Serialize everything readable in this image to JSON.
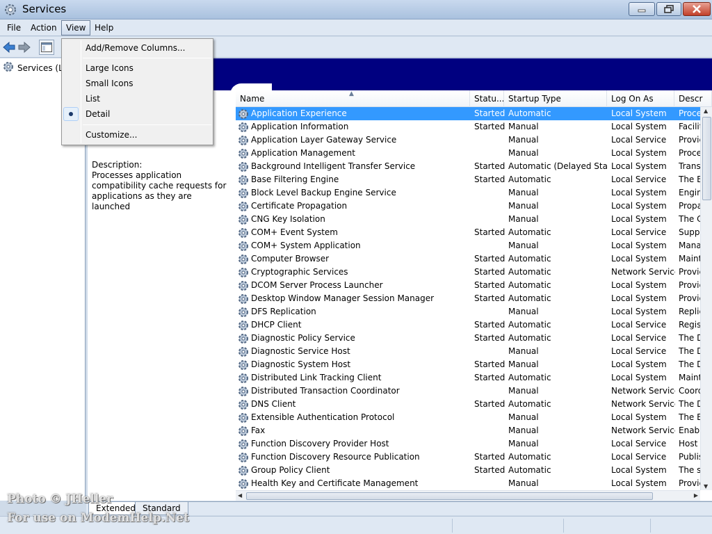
{
  "window": {
    "title": "Services"
  },
  "menubar": {
    "items": [
      "File",
      "Action",
      "View",
      "Help"
    ]
  },
  "tree": {
    "root_label": "Services (Lo"
  },
  "description": {
    "heading": "Description:",
    "text": "Processes application compatibility cache requests for applications as they are launched"
  },
  "view_menu": {
    "add_remove_columns": "Add/Remove Columns...",
    "large_icons": "Large Icons",
    "small_icons": "Small Icons",
    "list": "List",
    "detail": "Detail",
    "customize": "Customize...",
    "checked_item": "Detail"
  },
  "list": {
    "columns": [
      "Name",
      "Statu...",
      "Startup Type",
      "Log On As",
      "Descr"
    ],
    "sorted_column": "Name",
    "selected_row": "Application Experience",
    "rows": [
      {
        "name": "Application Experience",
        "status": "Started",
        "startup": "Automatic",
        "logon": "Local System",
        "desc": "Proce"
      },
      {
        "name": "Application Information",
        "status": "Started",
        "startup": "Manual",
        "logon": "Local System",
        "desc": "Facilit"
      },
      {
        "name": "Application Layer Gateway Service",
        "status": "",
        "startup": "Manual",
        "logon": "Local Service",
        "desc": "Provic"
      },
      {
        "name": "Application Management",
        "status": "",
        "startup": "Manual",
        "logon": "Local System",
        "desc": "Proce"
      },
      {
        "name": "Background Intelligent Transfer Service",
        "status": "Started",
        "startup": "Automatic (Delayed Start)",
        "logon": "Local System",
        "desc": "Trans"
      },
      {
        "name": "Base Filtering Engine",
        "status": "Started",
        "startup": "Automatic",
        "logon": "Local Service",
        "desc": "The B"
      },
      {
        "name": "Block Level Backup Engine Service",
        "status": "",
        "startup": "Manual",
        "logon": "Local System",
        "desc": "Engin"
      },
      {
        "name": "Certificate Propagation",
        "status": "",
        "startup": "Manual",
        "logon": "Local System",
        "desc": "Propa"
      },
      {
        "name": "CNG Key Isolation",
        "status": "",
        "startup": "Manual",
        "logon": "Local System",
        "desc": "The C"
      },
      {
        "name": "COM+ Event System",
        "status": "Started",
        "startup": "Automatic",
        "logon": "Local Service",
        "desc": "Suppo"
      },
      {
        "name": "COM+ System Application",
        "status": "",
        "startup": "Manual",
        "logon": "Local System",
        "desc": "Mana"
      },
      {
        "name": "Computer Browser",
        "status": "Started",
        "startup": "Automatic",
        "logon": "Local System",
        "desc": "Maint"
      },
      {
        "name": "Cryptographic Services",
        "status": "Started",
        "startup": "Automatic",
        "logon": "Network Service",
        "desc": "Provic"
      },
      {
        "name": "DCOM Server Process Launcher",
        "status": "Started",
        "startup": "Automatic",
        "logon": "Local System",
        "desc": "Provic"
      },
      {
        "name": "Desktop Window Manager Session Manager",
        "status": "Started",
        "startup": "Automatic",
        "logon": "Local System",
        "desc": "Provic"
      },
      {
        "name": "DFS Replication",
        "status": "",
        "startup": "Manual",
        "logon": "Local System",
        "desc": "Replic"
      },
      {
        "name": "DHCP Client",
        "status": "Started",
        "startup": "Automatic",
        "logon": "Local Service",
        "desc": "Regist"
      },
      {
        "name": "Diagnostic Policy Service",
        "status": "Started",
        "startup": "Automatic",
        "logon": "Local Service",
        "desc": "The D"
      },
      {
        "name": "Diagnostic Service Host",
        "status": "",
        "startup": "Manual",
        "logon": "Local Service",
        "desc": "The D"
      },
      {
        "name": "Diagnostic System Host",
        "status": "Started",
        "startup": "Manual",
        "logon": "Local System",
        "desc": "The D"
      },
      {
        "name": "Distributed Link Tracking Client",
        "status": "Started",
        "startup": "Automatic",
        "logon": "Local System",
        "desc": "Maint"
      },
      {
        "name": "Distributed Transaction Coordinator",
        "status": "",
        "startup": "Manual",
        "logon": "Network Service",
        "desc": "Coord"
      },
      {
        "name": "DNS Client",
        "status": "Started",
        "startup": "Automatic",
        "logon": "Network Service",
        "desc": "The D"
      },
      {
        "name": "Extensible Authentication Protocol",
        "status": "",
        "startup": "Manual",
        "logon": "Local System",
        "desc": "The E"
      },
      {
        "name": "Fax",
        "status": "",
        "startup": "Manual",
        "logon": "Network Service",
        "desc": "Enabl"
      },
      {
        "name": "Function Discovery Provider Host",
        "status": "",
        "startup": "Manual",
        "logon": "Local Service",
        "desc": "Host"
      },
      {
        "name": "Function Discovery Resource Publication",
        "status": "Started",
        "startup": "Automatic",
        "logon": "Local Service",
        "desc": "Publis"
      },
      {
        "name": "Group Policy Client",
        "status": "Started",
        "startup": "Automatic",
        "logon": "Local System",
        "desc": "The s"
      },
      {
        "name": "Health Key and Certificate Management",
        "status": "",
        "startup": "Manual",
        "logon": "Local System",
        "desc": "Provic"
      }
    ]
  },
  "tabs": [
    "Extended",
    "Standard"
  ],
  "watermark": {
    "line1": "Photo © JHeller",
    "line2": "For use on ModemHelp.Net"
  },
  "colors": {
    "banner": "#000080",
    "selection": "#3399ff"
  }
}
